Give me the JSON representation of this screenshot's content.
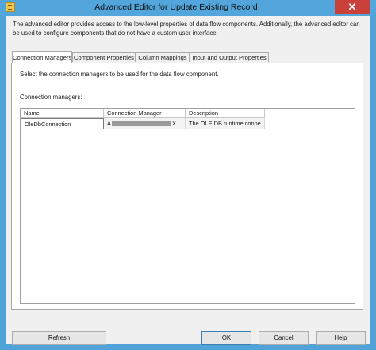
{
  "window": {
    "title": "Advanced Editor for Update Existing Record",
    "close_glyph": "✕"
  },
  "description": "The advanced editor provides access to the low-level properties of data flow components. Additionally, the advanced editor can be used to configure components that do not have a custom user interface.",
  "tabs": [
    {
      "label": "Connection Managers",
      "active": true
    },
    {
      "label": "Component Properties",
      "active": false
    },
    {
      "label": "Column Mappings",
      "active": false
    },
    {
      "label": "Input and Output Properties",
      "active": false
    }
  ],
  "page": {
    "instruction": "Select the connection managers to be used for the data flow component.",
    "list_label": "Connection managers:"
  },
  "grid": {
    "columns": [
      "Name",
      "Connection Manager",
      "Description"
    ],
    "rows": [
      {
        "name": "OleDbConnection",
        "manager_prefix": "A",
        "manager_suffix": "X",
        "description": "The OLE DB runtime conne..."
      }
    ]
  },
  "buttons": {
    "refresh": "Refresh",
    "ok": "OK",
    "cancel": "Cancel",
    "help": "Help"
  },
  "icons": {
    "app": "ssis-component-icon",
    "close": "close-icon"
  },
  "colors": {
    "titlebar": "#52a6dc",
    "close_button": "#c9413a",
    "dialog_bg": "#f0f0f0"
  }
}
